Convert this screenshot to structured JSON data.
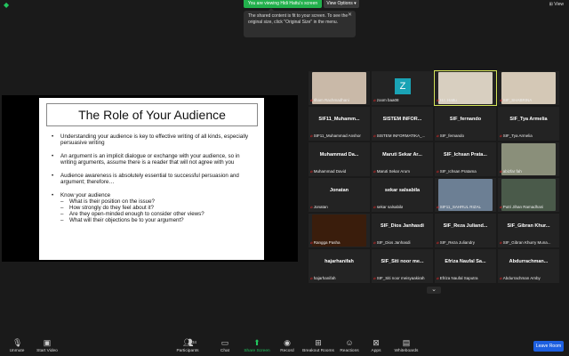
{
  "topbar": {
    "banner": "You are viewing Hidi Hattu's screen",
    "view_options": "View Options",
    "view": "View"
  },
  "tooltip": {
    "text": "The shared content is fit to your screen. To see the original size, click \"Original Size\" in the menu."
  },
  "slide": {
    "title": "The Role of Your Audience",
    "bullets": [
      "Understanding your audience is key to effective writing of all kinds, especially persuasive writing",
      "An argument is an implicit dialogue or exchange with your audience, so in writing arguments, assume there is a reader that will not agree with you",
      "Audience awareness is absolutely essential to successful persuasion and argument; therefore…",
      "Know your audience"
    ],
    "sub_bullets": [
      "What is their position on the issue?",
      "How strongly do they feel about it?",
      "Are they open-minded enough to consider other views?",
      "What will their objections be to your argument?"
    ]
  },
  "participants": [
    {
      "name": "",
      "label": "Ilham Rachmadhani",
      "kind": "photo",
      "color": "#c9b9a8"
    },
    {
      "name": "",
      "label": "zoom baa08",
      "kind": "z"
    },
    {
      "name": "",
      "label": "H.I. Hattu",
      "kind": "photo",
      "color": "#d8cfc0",
      "active": true
    },
    {
      "name": "",
      "label": "SIF_SHABRINA",
      "kind": "photo",
      "color": "#d4c8b6"
    },
    {
      "name": "SIF11_Muhamm...",
      "label": "SIF11_Muhammad Anshor",
      "kind": "name"
    },
    {
      "name": "SISTEM INFOR...",
      "label": "SISTEM INFORMATIKA_...",
      "kind": "name"
    },
    {
      "name": "SIF_fernando",
      "label": "SIF_fernando",
      "kind": "name"
    },
    {
      "name": "SIF_Tya Armelia",
      "label": "SIF_Tya Armelia",
      "kind": "name"
    },
    {
      "name": "Muhammad Da...",
      "label": "Muhammad David",
      "kind": "name"
    },
    {
      "name": "Maruti Sekar Ar...",
      "label": "Maruti Sekar Arum",
      "kind": "name"
    },
    {
      "name": "SIF_Ichsan Prata...",
      "label": "SIF_Ichsan Pratama",
      "kind": "name"
    },
    {
      "name": "",
      "label": "abizfar fah",
      "kind": "photo",
      "color": "#8a8f7a"
    },
    {
      "name": "Jonatan",
      "label": "Jonatan",
      "kind": "name"
    },
    {
      "name": "sekar salsabila",
      "label": "sekar salsabila",
      "kind": "name"
    },
    {
      "name": "",
      "label": "SIF11_SAHRUL RIZAL",
      "kind": "photo",
      "color": "#6c7f94"
    },
    {
      "name": "",
      "label": "Putri Jihan Ramadhani",
      "kind": "photo",
      "color": "#4a5a4a"
    },
    {
      "name": "",
      "label": "Rangga Pasha",
      "kind": "photo",
      "color": "#3a1d0c"
    },
    {
      "name": "SIF_Dios Janhasdi",
      "label": "SIF_Dios Janhasdi",
      "kind": "name"
    },
    {
      "name": "SIF_Reza Juliand...",
      "label": "SIF_Reza Juliandry",
      "kind": "name"
    },
    {
      "name": "SIF_Gibran Khur...",
      "label": "SIF_Gibran Khurry Muna...",
      "kind": "name"
    },
    {
      "name": "hajarhanifah",
      "label": "hajarhanifah",
      "kind": "name"
    },
    {
      "name": "SIF_Siti noor me...",
      "label": "SIF_Siti noor meisyaakirah",
      "kind": "name"
    },
    {
      "name": "Efriza Naufal Sa...",
      "label": "Efriza Naufal Saputra",
      "kind": "name"
    },
    {
      "name": "Abdurrachman...",
      "label": "Abdurrachman Amby",
      "kind": "name"
    }
  ],
  "toolbar": {
    "unmute": "Unmute",
    "start_video": "Start Video",
    "participants": "Participants",
    "participants_count": "34",
    "chat": "Chat",
    "share_screen": "Share Screen",
    "record": "Record",
    "breakout_rooms": "Breakout Rooms",
    "reactions": "Reactions",
    "apps": "Apps",
    "whiteboards": "Whiteboards",
    "leave_room": "Leave Room"
  },
  "icons": {
    "shield": "shield-icon",
    "close": "close-icon",
    "mic_muted": "mic-muted-icon",
    "video_off": "video-off-icon",
    "participants": "participants-icon",
    "chat": "chat-icon",
    "share": "share-screen-icon",
    "record": "record-icon",
    "breakout": "breakout-rooms-icon",
    "reactions": "reactions-icon",
    "apps": "apps-icon",
    "whiteboards": "whiteboards-icon",
    "chevron": "chevron-down-icon"
  },
  "colors": {
    "banner": "#22b14c",
    "active_speaker": "#d6e65a",
    "leave": "#1d5fe0",
    "share_screen": "#22c55e"
  }
}
